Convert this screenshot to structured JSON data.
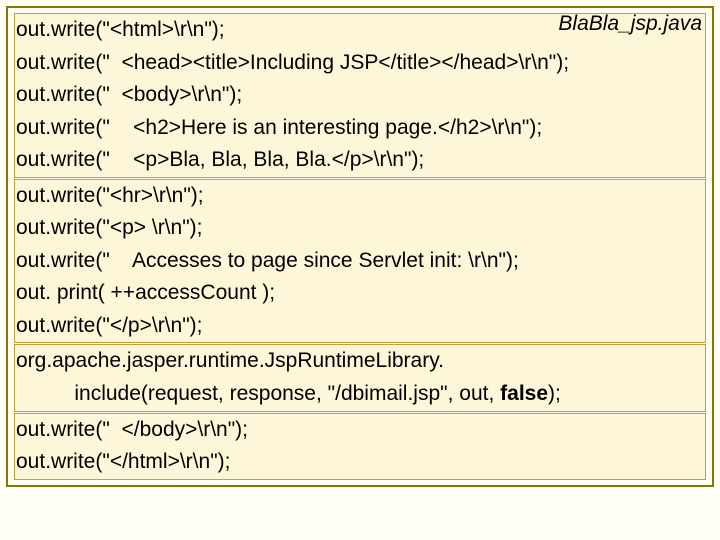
{
  "filename": "BlaBla_jsp.java",
  "sections": [
    {
      "lines": [
        "out.write(\"<html>\\r\\n\");",
        "out.write(\"  <head><title>Including JSP</title></head>\\r\\n\");",
        "out.write(\"  <body>\\r\\n\");",
        "out.write(\"    <h2>Here is an interesting page.</h2>\\r\\n\");",
        "out.write(\"    <p>Bla, Bla, Bla, Bla.</p>\\r\\n\");"
      ]
    },
    {
      "lines": [
        "out.write(\"<hr>\\r\\n\");",
        "out.write(\"<p> \\r\\n\");",
        "out.write(\"    Accesses to page since Servlet init: \\r\\n\");",
        "out. print( ++accessCount );",
        "out.write(\"</p>\\r\\n\");"
      ]
    },
    {
      "lines": [
        "org.apache.jasper.runtime.JspRuntimeLibrary."
      ],
      "special_line": {
        "prefix": "          include(request, response, \"/dbimail.jsp\", out, ",
        "bold": "false",
        "suffix": ");"
      }
    },
    {
      "lines": [
        "out.write(\"  </body>\\r\\n\");",
        "out.write(\"</html>\\r\\n\");"
      ]
    }
  ]
}
